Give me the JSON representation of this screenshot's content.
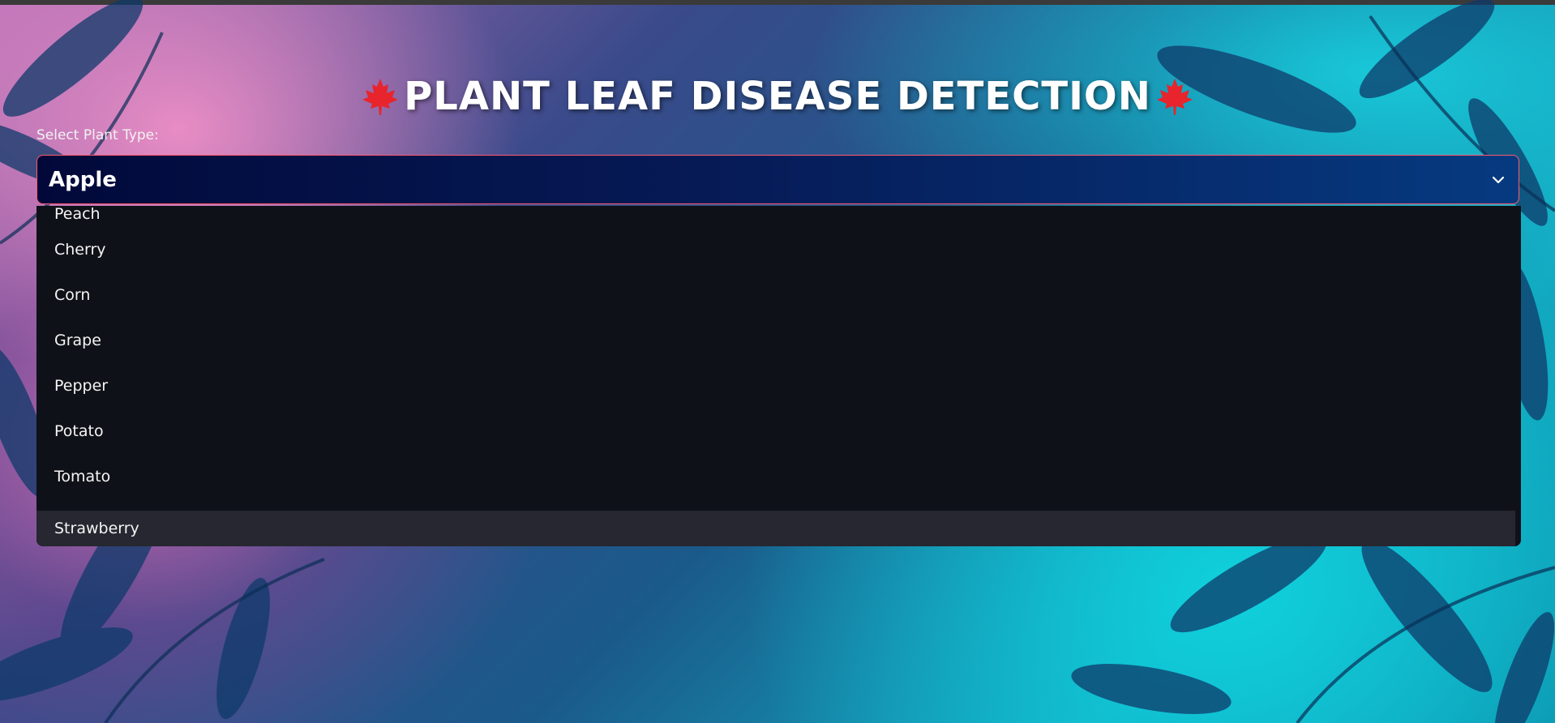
{
  "app": {
    "title": "PLANT LEAF DISEASE DETECTION",
    "title_icon": "maple-leaf-icon"
  },
  "select": {
    "label": "Select Plant Type:",
    "value": "Apple",
    "options": [
      "Peach",
      "Cherry",
      "Corn",
      "Grape",
      "Pepper",
      "Potato",
      "Tomato",
      "Strawberry"
    ],
    "highlighted": "Strawberry"
  },
  "colors": {
    "select_border": "#ff5a6e",
    "dropdown_bg": "#0f1118",
    "highlight_bg": "#262730",
    "maple_leaf": "#e8242c"
  }
}
